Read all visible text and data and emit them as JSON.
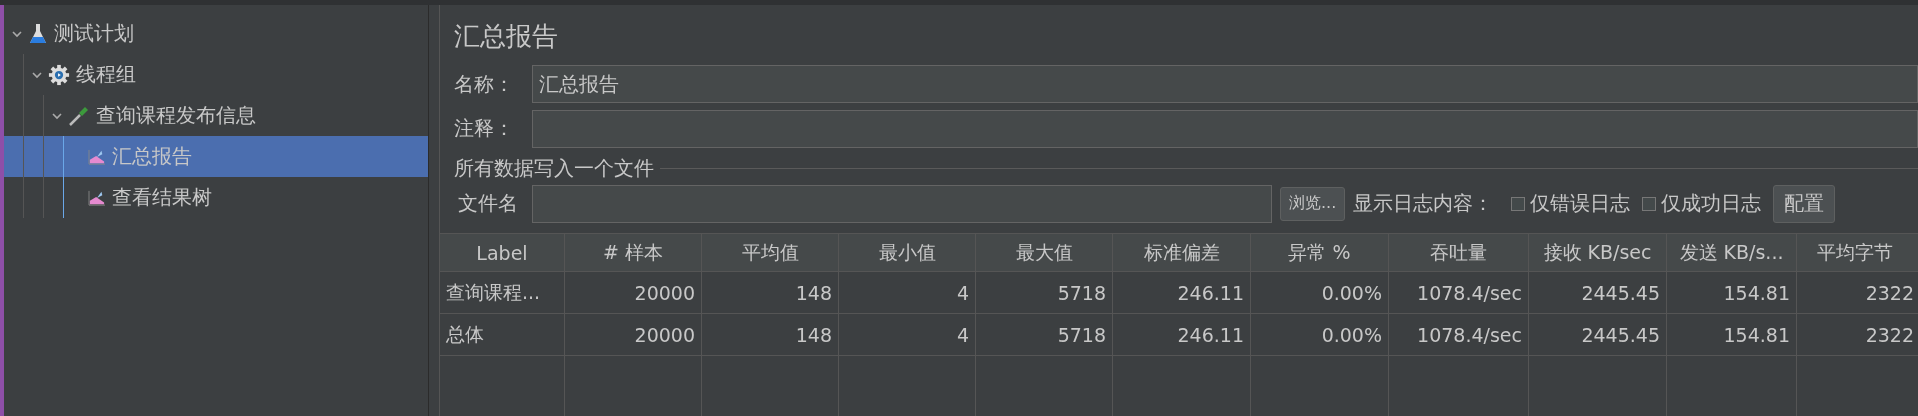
{
  "tree": [
    {
      "label": "测试计划",
      "kind": "plan",
      "expanded": true,
      "selected": false,
      "children": [
        {
          "label": "线程组",
          "kind": "group",
          "expanded": true,
          "selected": false,
          "children": [
            {
              "label": "查询课程发布信息",
              "kind": "sampler",
              "expanded": true,
              "selected": false,
              "children": [
                {
                  "label": "汇总报告",
                  "kind": "listener",
                  "selected": true
                },
                {
                  "label": "查看结果树",
                  "kind": "listener",
                  "selected": false
                }
              ]
            }
          ]
        }
      ]
    }
  ],
  "panel": {
    "title": "汇总报告",
    "name_field": {
      "label": "名称：",
      "value": "汇总报告"
    },
    "comment_field": {
      "label": "注释："
    },
    "file_group": {
      "title": "所有数据写入一个文件",
      "file_label": "文件名",
      "browse_button": "浏览...",
      "log_label": "显示日志内容：",
      "options": [
        {
          "label": "仅错误日志",
          "checked": false
        },
        {
          "label": "仅成功日志",
          "checked": false
        }
      ],
      "config_button": "配置"
    }
  },
  "table": {
    "columns": [
      "Label",
      "# 样本",
      "平均值",
      "最小值",
      "最大值",
      "标准偏差",
      "异常 %",
      "吞吐量",
      "接收 KB/sec",
      "发送 KB/s...",
      "平均字节"
    ],
    "rows": [
      [
        "查询课程...",
        "20000",
        "148",
        "4",
        "5718",
        "246.11",
        "0.00%",
        "1078.4/sec",
        "2445.45",
        "154.81",
        "2322"
      ],
      [
        "总体",
        "20000",
        "148",
        "4",
        "5718",
        "246.11",
        "0.00%",
        "1078.4/sec",
        "2445.45",
        "154.81",
        "2322"
      ]
    ]
  }
}
